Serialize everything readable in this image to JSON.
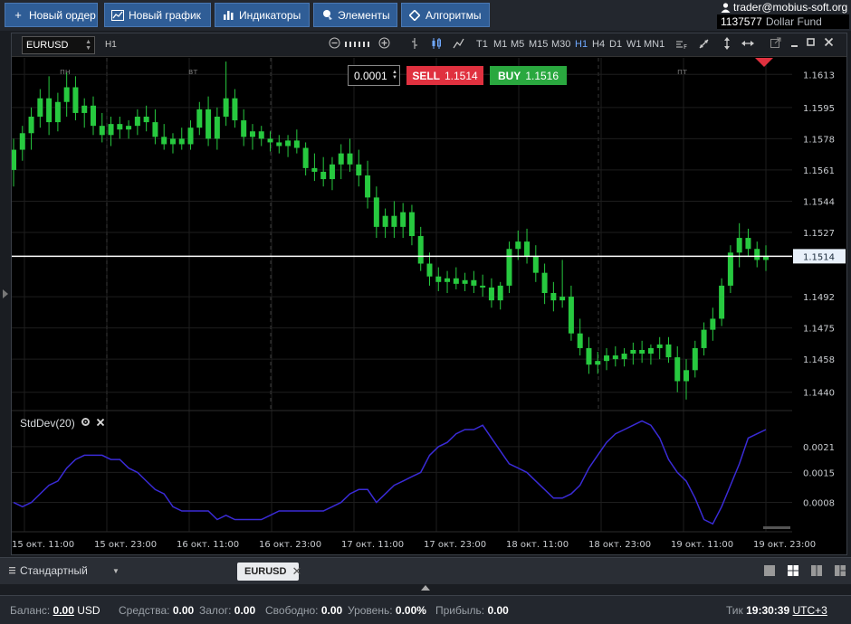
{
  "toolbar": {
    "new_order": "Новый ордер",
    "new_chart": "Новый график",
    "indicators": "Индикаторы",
    "elements": "Элементы",
    "algorithms": "Алгоритмы"
  },
  "account": {
    "user": "trader@mobius-soft.org",
    "number": "1137577",
    "fund": "Dollar Fund"
  },
  "chart": {
    "symbol": "EURUSD",
    "timeframe": "H1",
    "timeframes": [
      "T1",
      "M1",
      "M5",
      "M15",
      "M30",
      "H1",
      "H4",
      "D1",
      "W1",
      "MN1"
    ],
    "active_timeframe": "H1",
    "lot": "0.0001",
    "sell_label": "SELL",
    "sell_price": "1.1514",
    "buy_label": "BUY",
    "buy_price": "1.1516",
    "current_price": "1.1514",
    "indicator_name": "StdDev(20)",
    "day_labels": [
      "пн",
      "вт",
      "пт"
    ],
    "price_ticks": [
      "1.1613",
      "1.1595",
      "1.1578",
      "1.1561",
      "1.1544",
      "1.1527",
      "1.1492",
      "1.1475",
      "1.1458",
      "1.1440"
    ],
    "ind_ticks": [
      "0.0021",
      "0.0015",
      "0.0008"
    ],
    "time_labels": [
      "15 окт. 11:00",
      "15 окт. 23:00",
      "16 окт. 11:00",
      "16 окт. 23:00",
      "17 окт. 11:00",
      "17 окт. 23:00",
      "18 окт. 11:00",
      "18 окт. 23:00",
      "19 окт. 11:00",
      "19 окт. 23:00"
    ],
    "colors": {
      "up": "#27c93f",
      "down": "#27c93f",
      "stddev": "#3a2bd6",
      "price_line": "#ffffff",
      "background": "#000000"
    }
  },
  "chart_data": {
    "type": "candlestick",
    "series": [
      {
        "name": "EURUSD H1",
        "candles": [
          [
            1.1561,
            1.1578,
            1.1552,
            1.1572
          ],
          [
            1.1572,
            1.1585,
            1.1566,
            1.1581
          ],
          [
            1.1581,
            1.1595,
            1.1572,
            1.159
          ],
          [
            1.159,
            1.1605,
            1.1584,
            1.16
          ],
          [
            1.16,
            1.1612,
            1.158,
            1.1587
          ],
          [
            1.1587,
            1.1603,
            1.1582,
            1.1598
          ],
          [
            1.1598,
            1.1614,
            1.159,
            1.1606
          ],
          [
            1.1606,
            1.1612,
            1.1588,
            1.1592
          ],
          [
            1.1592,
            1.16,
            1.1584,
            1.1596
          ],
          [
            1.1596,
            1.1601,
            1.158,
            1.1585
          ],
          [
            1.1585,
            1.1592,
            1.1576,
            1.158
          ],
          [
            1.158,
            1.159,
            1.1574,
            1.1586
          ],
          [
            1.1586,
            1.159,
            1.1578,
            1.1583
          ],
          [
            1.1583,
            1.1588,
            1.1578,
            1.1585
          ],
          [
            1.1585,
            1.1594,
            1.158,
            1.159
          ],
          [
            1.159,
            1.1596,
            1.1582,
            1.1587
          ],
          [
            1.1587,
            1.1594,
            1.1575,
            1.1579
          ],
          [
            1.1579,
            1.1586,
            1.1572,
            1.1575
          ],
          [
            1.1575,
            1.1581,
            1.157,
            1.1578
          ],
          [
            1.1578,
            1.1584,
            1.1572,
            1.1575
          ],
          [
            1.1575,
            1.1588,
            1.1572,
            1.1584
          ],
          [
            1.1584,
            1.1598,
            1.158,
            1.1594
          ],
          [
            1.1594,
            1.1601,
            1.1574,
            1.1578
          ],
          [
            1.1578,
            1.1595,
            1.1572,
            1.159
          ],
          [
            1.159,
            1.162,
            1.1585,
            1.16
          ],
          [
            1.16,
            1.1605,
            1.1584,
            1.1588
          ],
          [
            1.1588,
            1.1594,
            1.1574,
            1.1579
          ],
          [
            1.1579,
            1.1586,
            1.1572,
            1.1582
          ],
          [
            1.1582,
            1.1585,
            1.1574,
            1.1578
          ],
          [
            1.1578,
            1.1582,
            1.1571,
            1.1576
          ],
          [
            1.1576,
            1.158,
            1.157,
            1.1574
          ],
          [
            1.1574,
            1.158,
            1.1568,
            1.1577
          ],
          [
            1.1577,
            1.1583,
            1.157,
            1.1573
          ],
          [
            1.1573,
            1.1576,
            1.1558,
            1.1562
          ],
          [
            1.1562,
            1.157,
            1.1555,
            1.156
          ],
          [
            1.156,
            1.1568,
            1.1552,
            1.1556
          ],
          [
            1.1556,
            1.1568,
            1.155,
            1.1564
          ],
          [
            1.1564,
            1.1575,
            1.1556,
            1.157
          ],
          [
            1.157,
            1.1578,
            1.156,
            1.1564
          ],
          [
            1.1564,
            1.1572,
            1.1552,
            1.1558
          ],
          [
            1.1558,
            1.1566,
            1.154,
            1.1546
          ],
          [
            1.1546,
            1.1552,
            1.1524,
            1.153
          ],
          [
            1.153,
            1.154,
            1.1524,
            1.1536
          ],
          [
            1.1536,
            1.1544,
            1.1524,
            1.153
          ],
          [
            1.153,
            1.1543,
            1.1524,
            1.1538
          ],
          [
            1.1538,
            1.1542,
            1.152,
            1.1525
          ],
          [
            1.1525,
            1.153,
            1.1506,
            1.151
          ],
          [
            1.151,
            1.1516,
            1.1498,
            1.1503
          ],
          [
            1.1503,
            1.1508,
            1.1495,
            1.15
          ],
          [
            1.15,
            1.1506,
            1.1494,
            1.1502
          ],
          [
            1.1502,
            1.1508,
            1.1496,
            1.1499
          ],
          [
            1.1499,
            1.1505,
            1.1495,
            1.1501
          ],
          [
            1.1501,
            1.1506,
            1.1494,
            1.1498
          ],
          [
            1.1498,
            1.1504,
            1.1492,
            1.1497
          ],
          [
            1.1497,
            1.1502,
            1.1486,
            1.149
          ],
          [
            1.149,
            1.15,
            1.1485,
            1.1498
          ],
          [
            1.1498,
            1.1522,
            1.1494,
            1.1518
          ],
          [
            1.1518,
            1.1528,
            1.1512,
            1.1522
          ],
          [
            1.1522,
            1.1529,
            1.151,
            1.1514
          ],
          [
            1.1514,
            1.152,
            1.15,
            1.1505
          ],
          [
            1.1505,
            1.151,
            1.1488,
            1.1494
          ],
          [
            1.1494,
            1.15,
            1.1484,
            1.149
          ],
          [
            1.149,
            1.1512,
            1.1486,
            1.1492
          ],
          [
            1.1492,
            1.1498,
            1.1468,
            1.1472
          ],
          [
            1.1472,
            1.148,
            1.146,
            1.1464
          ],
          [
            1.1464,
            1.147,
            1.145,
            1.1455
          ],
          [
            1.1455,
            1.1462,
            1.145,
            1.1457
          ],
          [
            1.1457,
            1.1464,
            1.1452,
            1.146
          ],
          [
            1.146,
            1.1465,
            1.1454,
            1.1458
          ],
          [
            1.1458,
            1.1464,
            1.1454,
            1.1461
          ],
          [
            1.1461,
            1.1467,
            1.1455,
            1.1463
          ],
          [
            1.1463,
            1.1468,
            1.1456,
            1.1461
          ],
          [
            1.1461,
            1.1466,
            1.1455,
            1.1464
          ],
          [
            1.1464,
            1.147,
            1.1458,
            1.1466
          ],
          [
            1.1466,
            1.147,
            1.1456,
            1.1459
          ],
          [
            1.1459,
            1.1465,
            1.144,
            1.1446
          ],
          [
            1.1446,
            1.1458,
            1.1436,
            1.1452
          ],
          [
            1.1452,
            1.1468,
            1.1448,
            1.1464
          ],
          [
            1.1464,
            1.1478,
            1.146,
            1.1474
          ],
          [
            1.1474,
            1.1486,
            1.1468,
            1.148
          ],
          [
            1.148,
            1.1502,
            1.1476,
            1.1498
          ],
          [
            1.1498,
            1.152,
            1.1494,
            1.1516
          ],
          [
            1.1516,
            1.1532,
            1.1508,
            1.1524
          ],
          [
            1.1524,
            1.1529,
            1.1514,
            1.1518
          ],
          [
            1.1518,
            1.1522,
            1.1508,
            1.1512
          ],
          [
            1.1512,
            1.152,
            1.1506,
            1.1514
          ]
        ]
      },
      {
        "name": "StdDev(20)",
        "values": [
          0.0008,
          0.0007,
          0.0008,
          0.001,
          0.0012,
          0.0013,
          0.0016,
          0.0018,
          0.0019,
          0.0019,
          0.0019,
          0.0018,
          0.0018,
          0.0016,
          0.0015,
          0.0013,
          0.0011,
          0.001,
          0.0007,
          0.0006,
          0.0006,
          0.0006,
          0.0006,
          0.0004,
          0.0005,
          0.0004,
          0.0004,
          0.0004,
          0.0004,
          0.0005,
          0.0006,
          0.0006,
          0.0006,
          0.0006,
          0.0006,
          0.0006,
          0.0007,
          0.0008,
          0.001,
          0.0011,
          0.0011,
          0.0008,
          0.001,
          0.0012,
          0.0013,
          0.0014,
          0.0015,
          0.0019,
          0.0021,
          0.0022,
          0.0024,
          0.0025,
          0.0025,
          0.0026,
          0.0023,
          0.002,
          0.0017,
          0.0016,
          0.0015,
          0.0013,
          0.0011,
          0.0009,
          0.0009,
          0.001,
          0.0012,
          0.0016,
          0.0019,
          0.0022,
          0.0024,
          0.0025,
          0.0026,
          0.0027,
          0.0026,
          0.0023,
          0.0018,
          0.0015,
          0.0013,
          0.0009,
          0.0004,
          0.0003,
          0.0007,
          0.0012,
          0.0017,
          0.0023,
          0.0024,
          0.0025
        ]
      }
    ],
    "ylim": [
      1.143,
      1.1622
    ],
    "indicator_ylim": [
      0.0002,
      0.0029
    ]
  },
  "tabs": {
    "layout": "Стандартный",
    "active_tab": "EURUSD"
  },
  "status": {
    "balance_label": "Баланс:",
    "balance_value": "0.00",
    "balance_ccy": "USD",
    "equity_label": "Средства:",
    "equity_value": "0.00",
    "margin_label": "Залог:",
    "margin_value": "0.00",
    "free_label": "Свободно:",
    "free_value": "0.00",
    "level_label": "Уровень:",
    "level_value": "0.00%",
    "profit_label": "Прибыль:",
    "profit_value": "0.00",
    "tick_label": "Тик",
    "tick_time": "19:30:39",
    "timezone": "UTC+3"
  }
}
